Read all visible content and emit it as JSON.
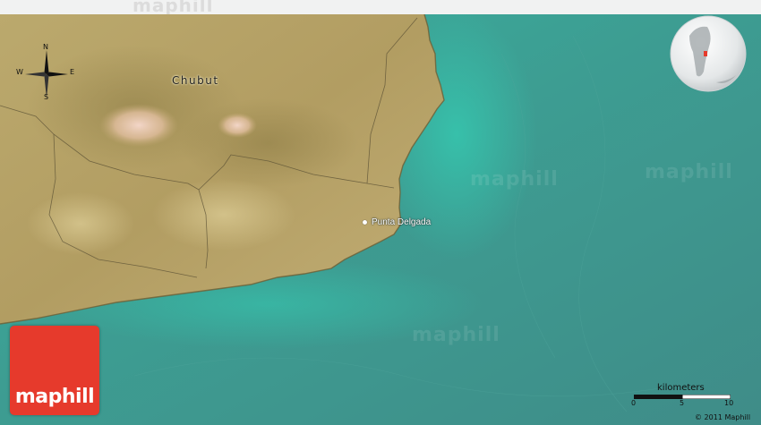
{
  "header": {
    "watermark": "maphill"
  },
  "map": {
    "region_label": "Chubut",
    "place_label": "Punta Delgada",
    "watermarks": [
      "maphill",
      "maphill",
      "maphill"
    ]
  },
  "compass": {
    "north": "N",
    "south": "S",
    "east": "E",
    "west": "W"
  },
  "scale_bar": {
    "title": "kilometers",
    "ticks": [
      "0",
      "5",
      "10"
    ]
  },
  "logo": {
    "text": "maphill"
  },
  "copyright": "© 2011 Maphill",
  "colors": {
    "land": "#b9a469",
    "sea": "#3e9a90",
    "logo": "#e63a2c",
    "locator_marker": "#e63a2c"
  }
}
